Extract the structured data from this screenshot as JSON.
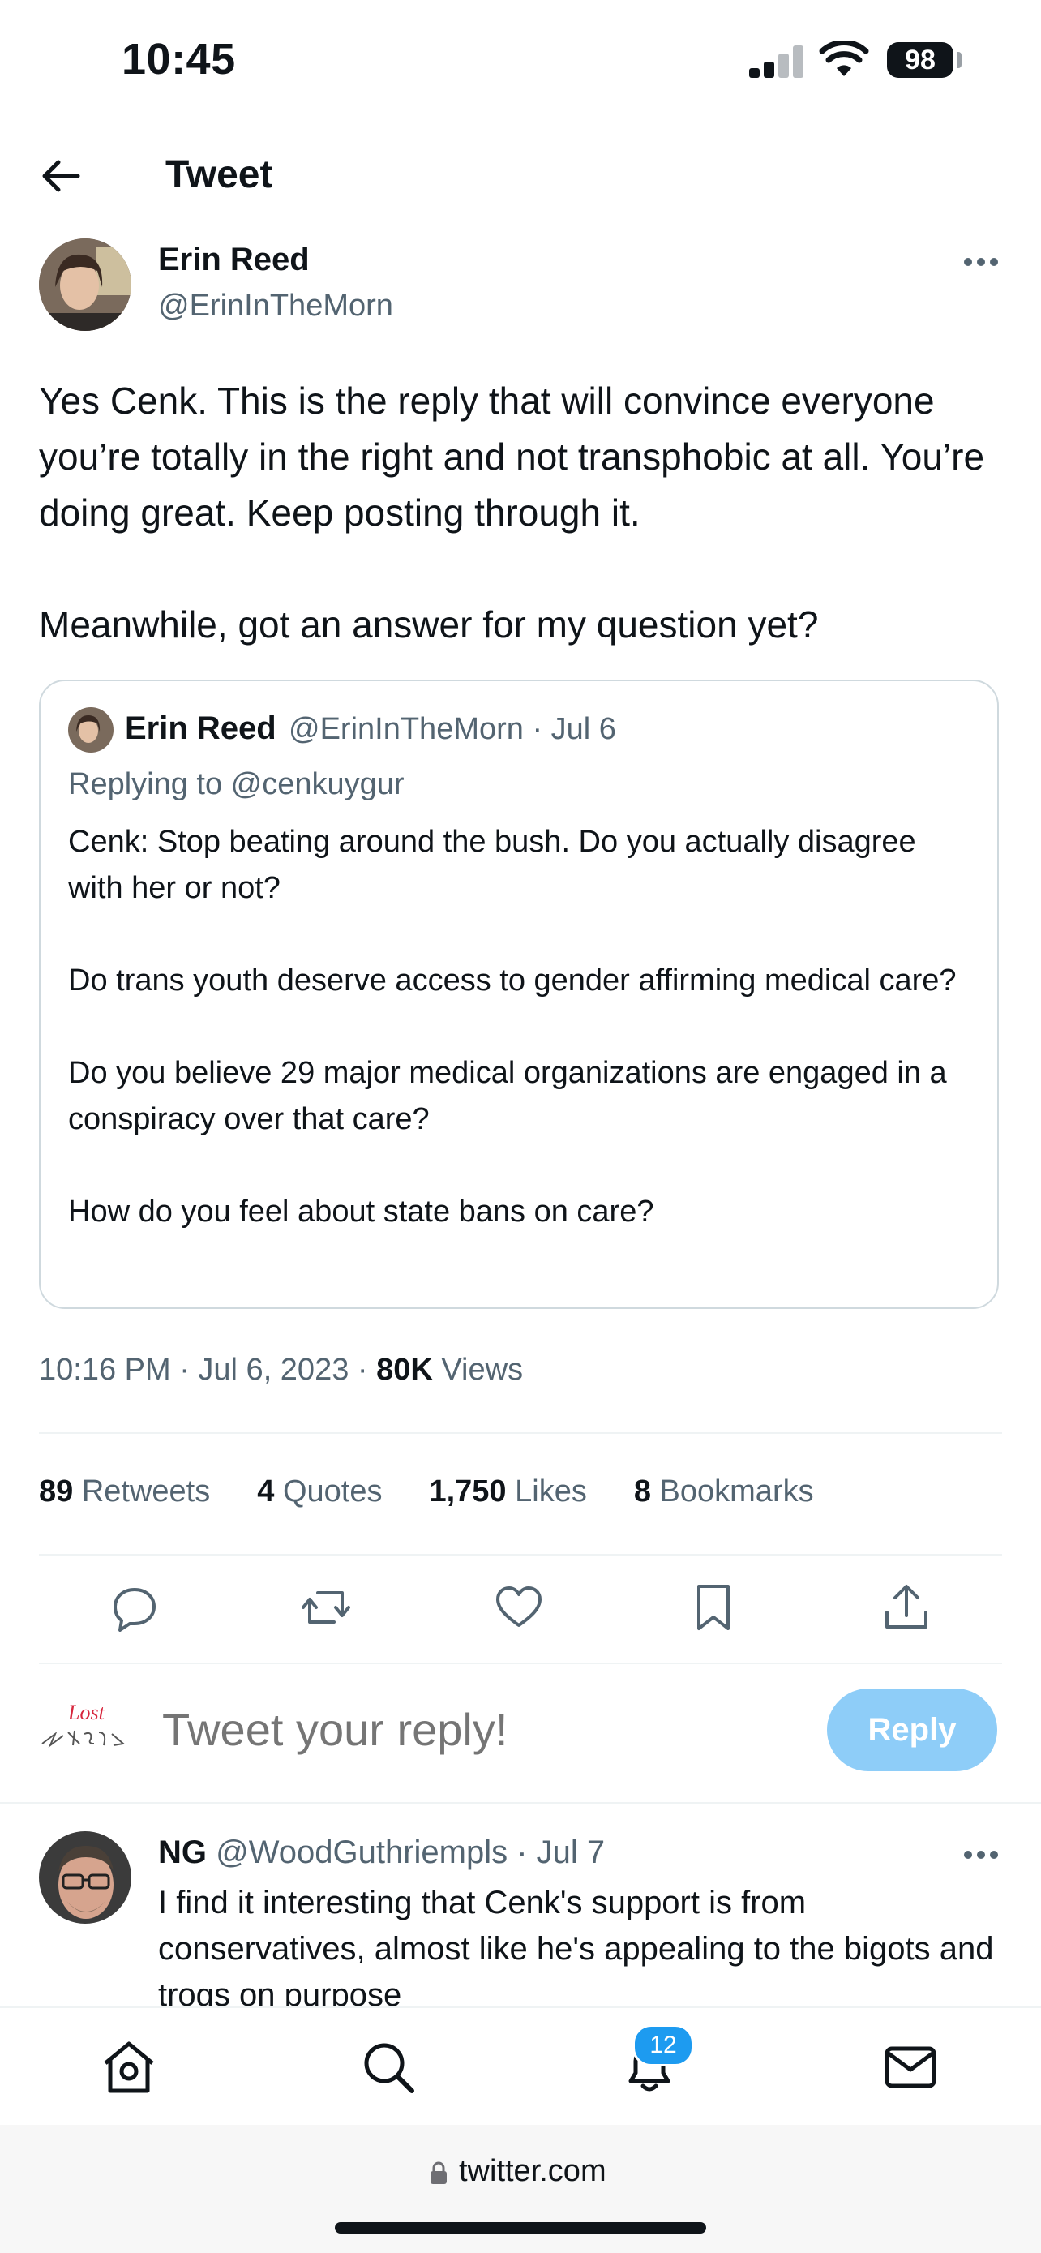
{
  "status_bar": {
    "time": "10:45",
    "battery": "98"
  },
  "header": {
    "title": "Tweet"
  },
  "tweet": {
    "author_name": "Erin Reed",
    "author_handle": "@ErinInTheMorn",
    "text": "Yes Cenk. This is the reply that will convince everyone you’re totally in the right and not transphobic at all. You’re doing great. Keep posting through it.\n\nMeanwhile, got an answer for my question yet?",
    "quote": {
      "name": "Erin Reed",
      "meta": "@ErinInTheMorn · Jul 6",
      "replying_to": "Replying to @cenkuygur",
      "text": "Cenk: Stop beating around the bush. Do you actually disagree with her or not?\n\nDo trans youth deserve access to gender affirming medical care?\n\nDo you believe 29 major medical organizations are engaged in a conspiracy over that care?\n\nHow do you feel about state bans on care?"
    },
    "timestamp": "10:16 PM · Jul 6, 2023 · ",
    "views_count": "80K",
    "views_label": " Views",
    "stats": {
      "retweets_count": "89",
      "retweets_label": " Retweets",
      "quotes_count": "4",
      "quotes_label": " Quotes",
      "likes_count": "1,750",
      "likes_label": " Likes",
      "bookmarks_count": "8",
      "bookmarks_label": " Bookmarks"
    }
  },
  "composer": {
    "placeholder": "Tweet your reply!",
    "reply_button": "Reply",
    "avatar_text": "Lost"
  },
  "reply_tweet": {
    "name": "NG",
    "meta": " @WoodGuthriempls · Jul 7",
    "text": "I find it interesting that Cenk's support is from conservatives, almost like he's appealing to the bigots and trogs on purpose"
  },
  "tabbar": {
    "notification_badge": "12"
  },
  "browser": {
    "url": "twitter.com"
  },
  "colors": {
    "accent": "#1d9bf0",
    "reply_button": "#8ecdf8",
    "secondary_text": "#536471"
  },
  "icons": [
    "back-arrow-icon",
    "more-icon",
    "reply-icon",
    "retweet-icon",
    "like-icon",
    "bookmark-icon",
    "share-icon",
    "home-icon",
    "search-icon",
    "notifications-icon",
    "messages-icon",
    "lock-icon"
  ]
}
